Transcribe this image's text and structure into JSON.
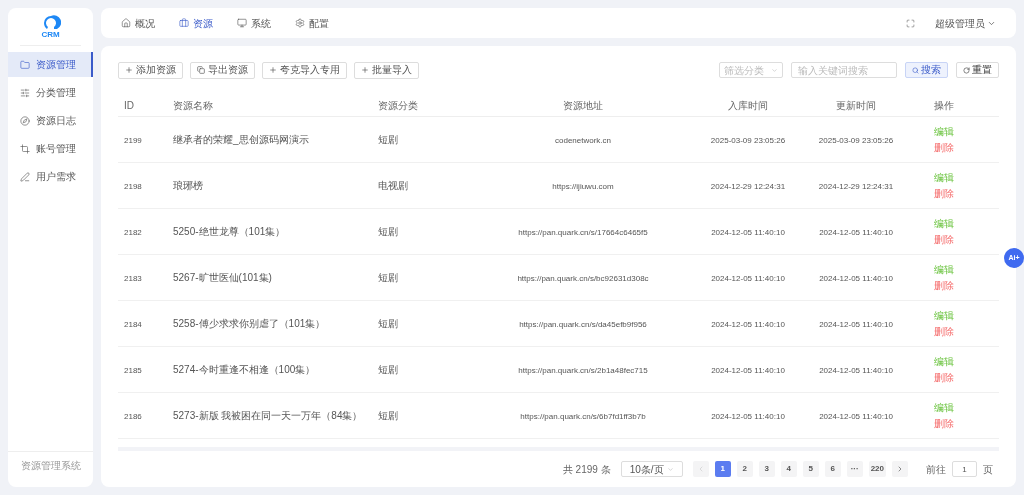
{
  "logo": {
    "text": "CRM"
  },
  "top_nav": [
    {
      "label": "概况",
      "selected": false
    },
    {
      "label": "资源",
      "selected": true
    },
    {
      "label": "系统",
      "selected": false
    },
    {
      "label": "配置",
      "selected": false
    }
  ],
  "user_menu": {
    "label": "超级管理员"
  },
  "sidebar": {
    "items": [
      {
        "label": "资源管理",
        "selected": true
      },
      {
        "label": "分类管理",
        "selected": false
      },
      {
        "label": "资源日志",
        "selected": false
      },
      {
        "label": "账号管理",
        "selected": false
      },
      {
        "label": "用户需求",
        "selected": false
      }
    ],
    "footer": "资源管理系统"
  },
  "toolbar": {
    "buttons": [
      {
        "label": "添加资源"
      },
      {
        "label": "导出资源"
      },
      {
        "label": "夸克导入专用"
      },
      {
        "label": "批量导入"
      }
    ],
    "filter": {
      "placeholder": "筛选分类"
    },
    "search": {
      "placeholder": "输入关键词搜索"
    },
    "search_button": "搜索",
    "reset_button": "重置"
  },
  "table": {
    "columns": [
      "ID",
      "资源名称",
      "资源分类",
      "资源地址",
      "入库时间",
      "更新时间",
      "操作"
    ],
    "rows": [
      {
        "id": "2199",
        "name": "继承者的荣耀_思创源码网演示",
        "category": "短剧",
        "url": "codenetwork.cn",
        "created": "2025-03-09 23:05:26",
        "updated": "2025-03-09 23:05:26",
        "edit": "编辑",
        "delete": "删除"
      },
      {
        "id": "2198",
        "name": "琅琊榜",
        "category": "电视剧",
        "url": "https://ijiuwu.com",
        "created": "2024-12-29 12:24:31",
        "updated": "2024-12-29 12:24:31",
        "edit": "编辑",
        "delete": "删除"
      },
      {
        "id": "2182",
        "name": "5250-绝世龙尊（101集）",
        "category": "短剧",
        "url": "https://pan.quark.cn/s/17664c6465f5",
        "created": "2024-12-05 11:40:10",
        "updated": "2024-12-05 11:40:10",
        "edit": "编辑",
        "delete": "删除"
      },
      {
        "id": "2183",
        "name": "5267-旷世医仙(101集)",
        "category": "短剧",
        "url": "https://pan.quark.cn/s/bc92631d308c",
        "created": "2024-12-05 11:40:10",
        "updated": "2024-12-05 11:40:10",
        "edit": "编辑",
        "delete": "删除"
      },
      {
        "id": "2184",
        "name": "5258-傅少求求你别虐了（101集）",
        "category": "短剧",
        "url": "https://pan.quark.cn/s/da45efb9f956",
        "created": "2024-12-05 11:40:10",
        "updated": "2024-12-05 11:40:10",
        "edit": "编辑",
        "delete": "删除"
      },
      {
        "id": "2185",
        "name": "5274-今时重逢不相逢（100集）",
        "category": "短剧",
        "url": "https://pan.quark.cn/s/2b1a48fec715",
        "created": "2024-12-05 11:40:10",
        "updated": "2024-12-05 11:40:10",
        "edit": "编辑",
        "delete": "删除"
      },
      {
        "id": "2186",
        "name": "5273-新版 我被困在同一天一万年（84集）",
        "category": "短剧",
        "url": "https://pan.quark.cn/s/6b7fd1ff3b7b",
        "created": "2024-12-05 11:40:10",
        "updated": "2024-12-05 11:40:10",
        "edit": "编辑",
        "delete": "删除"
      }
    ]
  },
  "pagination": {
    "total": "共 2199 条",
    "page_size": "10条/页",
    "pages": [
      {
        "label": "1",
        "selected": true
      },
      {
        "label": "2",
        "selected": false
      },
      {
        "label": "3",
        "selected": false
      },
      {
        "label": "4",
        "selected": false
      },
      {
        "label": "5",
        "selected": false
      },
      {
        "label": "6",
        "selected": false
      },
      {
        "label": "···",
        "selected": false
      },
      {
        "label": "220",
        "selected": false
      }
    ],
    "goto_label": "前往",
    "goto_value": "1",
    "goto_suffix": "页"
  },
  "ai_badge": "Ai+"
}
